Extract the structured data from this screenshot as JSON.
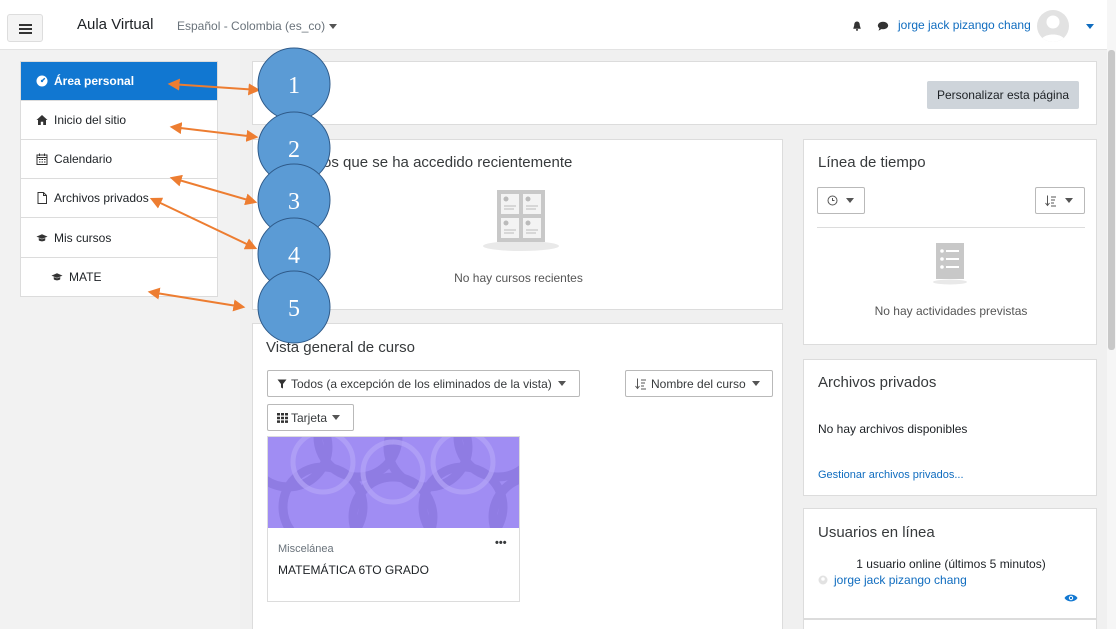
{
  "navbar": {
    "site_name": "Aula Virtual",
    "language": "Español - Colombia (es_co)",
    "user_name": "jorge jack pizango chang",
    "menu_icon": "hamburger-icon",
    "notification_icon": "bell-icon",
    "messages_icon": "chat-bubble-icon"
  },
  "drawer": {
    "items": [
      {
        "label": "Área personal",
        "icon": "dashboard-icon"
      },
      {
        "label": "Inicio del sitio",
        "icon": "home-icon"
      },
      {
        "label": "Calendario",
        "icon": "calendar-icon"
      },
      {
        "label": "Archivos privados",
        "icon": "file-icon"
      },
      {
        "label": "Mis cursos",
        "icon": "graduation-cap-icon"
      }
    ],
    "courses": [
      {
        "label": "MATE",
        "icon": "graduation-cap-icon"
      }
    ]
  },
  "page": {
    "customise_button": "Personalizar esta página"
  },
  "recent": {
    "title": "os que se ha accedido recientemente",
    "empty": "No hay cursos recientes"
  },
  "timeline": {
    "title": "Línea de tiempo",
    "empty": "No hay actividades previstas"
  },
  "overview": {
    "title": "Vista general de curso",
    "filter": "Todos (a excepción de los eliminados de la vista)",
    "sort": "Nombre del curso",
    "view": "Tarjeta",
    "course": {
      "category": "Miscelánea",
      "name": "MATEMÁTICA 6TO GRADO",
      "menu": "•••"
    }
  },
  "files": {
    "title": "Archivos privados",
    "empty": "No hay archivos disponibles",
    "manage_link": "Gestionar archivos privados..."
  },
  "online": {
    "title": "Usuarios en línea",
    "summary": "1 usuario online (últimos 5 minutos)",
    "user": "jorge jack pizango chang"
  },
  "annotations": {
    "labels": [
      "1",
      "2",
      "3",
      "4",
      "5"
    ],
    "circle_color": "#5b9bd5",
    "arrow_color": "#ed7d31"
  },
  "colors": {
    "primary": "#1177d1",
    "link": "#0f6cbf",
    "course_image": "#9f8bf2"
  }
}
